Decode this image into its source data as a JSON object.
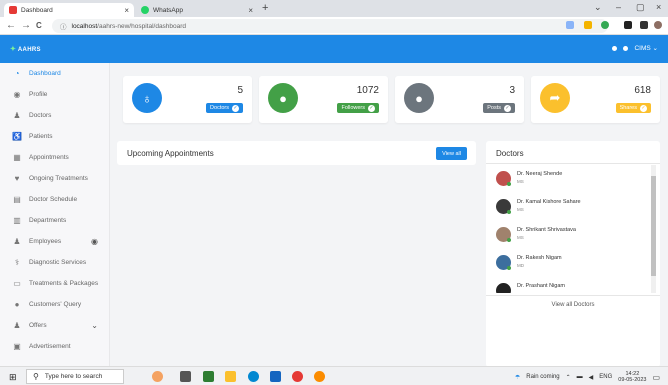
{
  "browser": {
    "tabs": [
      {
        "label": "Dashboard",
        "close": "×",
        "color": "#e53935"
      },
      {
        "label": "WhatsApp",
        "close": "×",
        "color": "#25d366"
      }
    ],
    "new_tab": "+",
    "window_controls": {
      "tab_search": "⌄",
      "minimize": "–",
      "maximize": "▢",
      "close": "×"
    },
    "nav": {
      "back": "←",
      "forward": "→",
      "reload": "C"
    },
    "url_host": "localhost",
    "url_path": "/aahrs-new/hospital/dashboard"
  },
  "app": {
    "brand": "AAHRS",
    "user_label": "CIMS",
    "user_caret": "⌄"
  },
  "sidebar": {
    "items": [
      {
        "label": "Dashboard",
        "icon": "dashboard-icon",
        "glyph": "◔",
        "active": true
      },
      {
        "label": "Profile",
        "icon": "profile-icon",
        "glyph": "◉"
      },
      {
        "label": "Doctors",
        "icon": "doctor-icon",
        "glyph": "♟"
      },
      {
        "label": "Patients",
        "icon": "patient-icon",
        "glyph": "♿"
      },
      {
        "label": "Appointments",
        "icon": "calendar-icon",
        "glyph": "▦"
      },
      {
        "label": "Ongoing Treatments",
        "icon": "heart-icon",
        "glyph": "♥"
      },
      {
        "label": "Doctor Schedule",
        "icon": "schedule-icon",
        "glyph": "▤"
      },
      {
        "label": "Departments",
        "icon": "building-icon",
        "glyph": "▥"
      },
      {
        "label": "Employees",
        "icon": "employee-icon",
        "glyph": "♟",
        "tail": "◉"
      },
      {
        "label": "Diagnostic Services",
        "icon": "stethoscope-icon",
        "glyph": "⚕"
      },
      {
        "label": "Treatments & Packages",
        "icon": "bed-icon",
        "glyph": "▭"
      },
      {
        "label": "Customers' Query",
        "icon": "comments-icon",
        "glyph": "●"
      },
      {
        "label": "Offers",
        "icon": "offer-icon",
        "glyph": "♟",
        "tail": "⌄"
      },
      {
        "label": "Advertisement",
        "icon": "ad-icon",
        "glyph": "▣"
      }
    ]
  },
  "stats": [
    {
      "value": "5",
      "label": "Doctors",
      "icon": "stethoscope-icon",
      "glyph": "♁",
      "color": "#1e88e5"
    },
    {
      "value": "1072",
      "label": "Followers",
      "icon": "user-icon",
      "glyph": "●",
      "color": "#43a047"
    },
    {
      "value": "3",
      "label": "Posts",
      "icon": "chat-icon",
      "glyph": "●",
      "color": "#6c757d"
    },
    {
      "value": "618",
      "label": "Shares",
      "icon": "share-icon",
      "glyph": "➦",
      "color": "#fbc02d"
    }
  ],
  "appointments": {
    "title": "Upcoming Appointments",
    "view_all": "View all"
  },
  "doctors": {
    "title": "Doctors",
    "list": [
      {
        "name": "Dr. Neeraj Shende",
        "qual": "MS",
        "avatar": "#c0504d"
      },
      {
        "name": "Dr. Kamal Kishore Sahare",
        "qual": "MS",
        "avatar": "#3a3a3a"
      },
      {
        "name": "Dr. Shrikant Shrivastava",
        "qual": "MS",
        "avatar": "#a0826d"
      },
      {
        "name": "Dr. Rakesh Nigam",
        "qual": "MD",
        "avatar": "#3c6e9e"
      },
      {
        "name": "Dr. Prashant Nigam",
        "qual": "",
        "avatar": "#222222"
      }
    ],
    "view_all": "View all Doctors"
  },
  "taskbar": {
    "search_placeholder": "Type here to search",
    "weather": "Rain coming",
    "lang": "ENG",
    "time": "14:22",
    "date": "09-05-2023"
  }
}
